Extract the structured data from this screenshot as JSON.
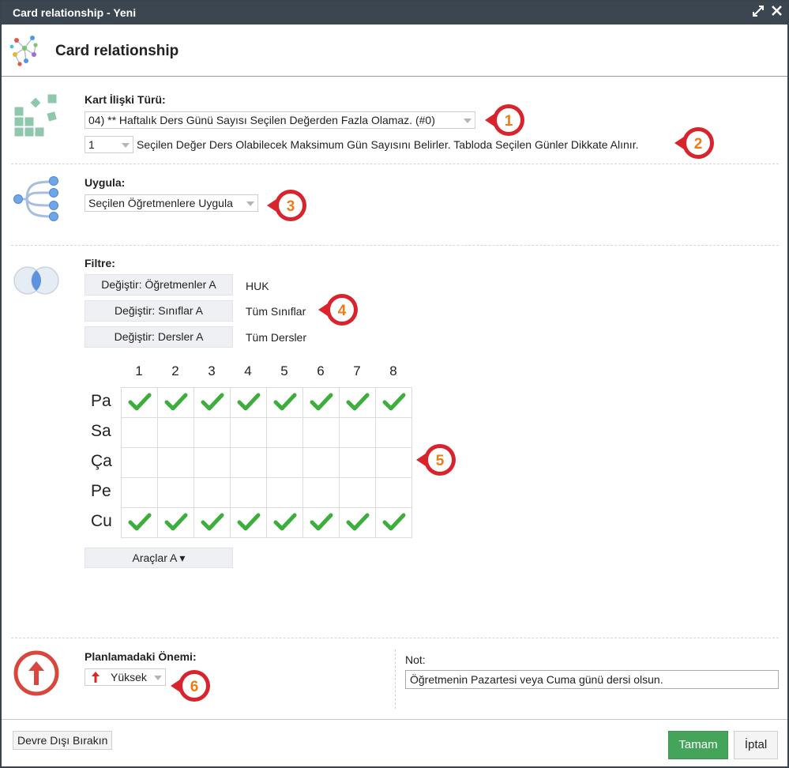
{
  "window": {
    "title": "Card relationship - Yeni",
    "maximize_icon": "expand-icon",
    "close_icon": "close-icon"
  },
  "header": {
    "title": "Card relationship"
  },
  "relation_type": {
    "label": "Kart İlişki Türü:",
    "selected": "04) ** Haftalık Ders Günü Sayısı Seçilen Değerden Fazla Olamaz. (#0)",
    "value_selected": "1",
    "value_description": "Seçilen Değer Ders Olabilecek Maksimum Gün Sayısını Belirler. Tabloda Seçilen Günler Dikkate Alınır."
  },
  "apply": {
    "label": "Uygula:",
    "selected": "Seçilen Öğretmenlere Uygula"
  },
  "filter": {
    "label": "Filtre:",
    "rows": [
      {
        "button": "Değiştir: Öğretmenler A",
        "value": "HUK"
      },
      {
        "button": "Değiştir: Sınıflar A",
        "value": "Tüm Sınıflar"
      },
      {
        "button": "Değiştir: Dersler A",
        "value": "Tüm Dersler"
      }
    ]
  },
  "grid": {
    "columns": [
      "1",
      "2",
      "3",
      "4",
      "5",
      "6",
      "7",
      "8"
    ],
    "rows": [
      "Pa",
      "Sa",
      "Ça",
      "Pe",
      "Cu"
    ],
    "checked": [
      [
        true,
        true,
        true,
        true,
        true,
        true,
        true,
        true
      ],
      [
        false,
        false,
        false,
        false,
        false,
        false,
        false,
        false
      ],
      [
        false,
        false,
        false,
        false,
        false,
        false,
        false,
        false
      ],
      [
        false,
        false,
        false,
        false,
        false,
        false,
        false,
        false
      ],
      [
        true,
        true,
        true,
        true,
        true,
        true,
        true,
        true
      ]
    ],
    "check_color": "#3cae3c"
  },
  "tools": {
    "label": "Araçlar A ▾"
  },
  "importance": {
    "label": "Planlamadaki Önemi:",
    "selected": "Yüksek"
  },
  "note": {
    "label": "Not:",
    "value": "Öğretmenin Pazartesi veya Cuma günü dersi olsun."
  },
  "footer": {
    "disable_label": "Devre Dışı Bırakın",
    "ok_label": "Tamam",
    "cancel_label": "İptal"
  },
  "badges": [
    "1",
    "2",
    "3",
    "4",
    "5",
    "6"
  ],
  "colors": {
    "titlebar": "#3b4651",
    "badge_ring": "#d9242e",
    "ok_button": "#44a55a",
    "badge_number": "#f07a17"
  }
}
